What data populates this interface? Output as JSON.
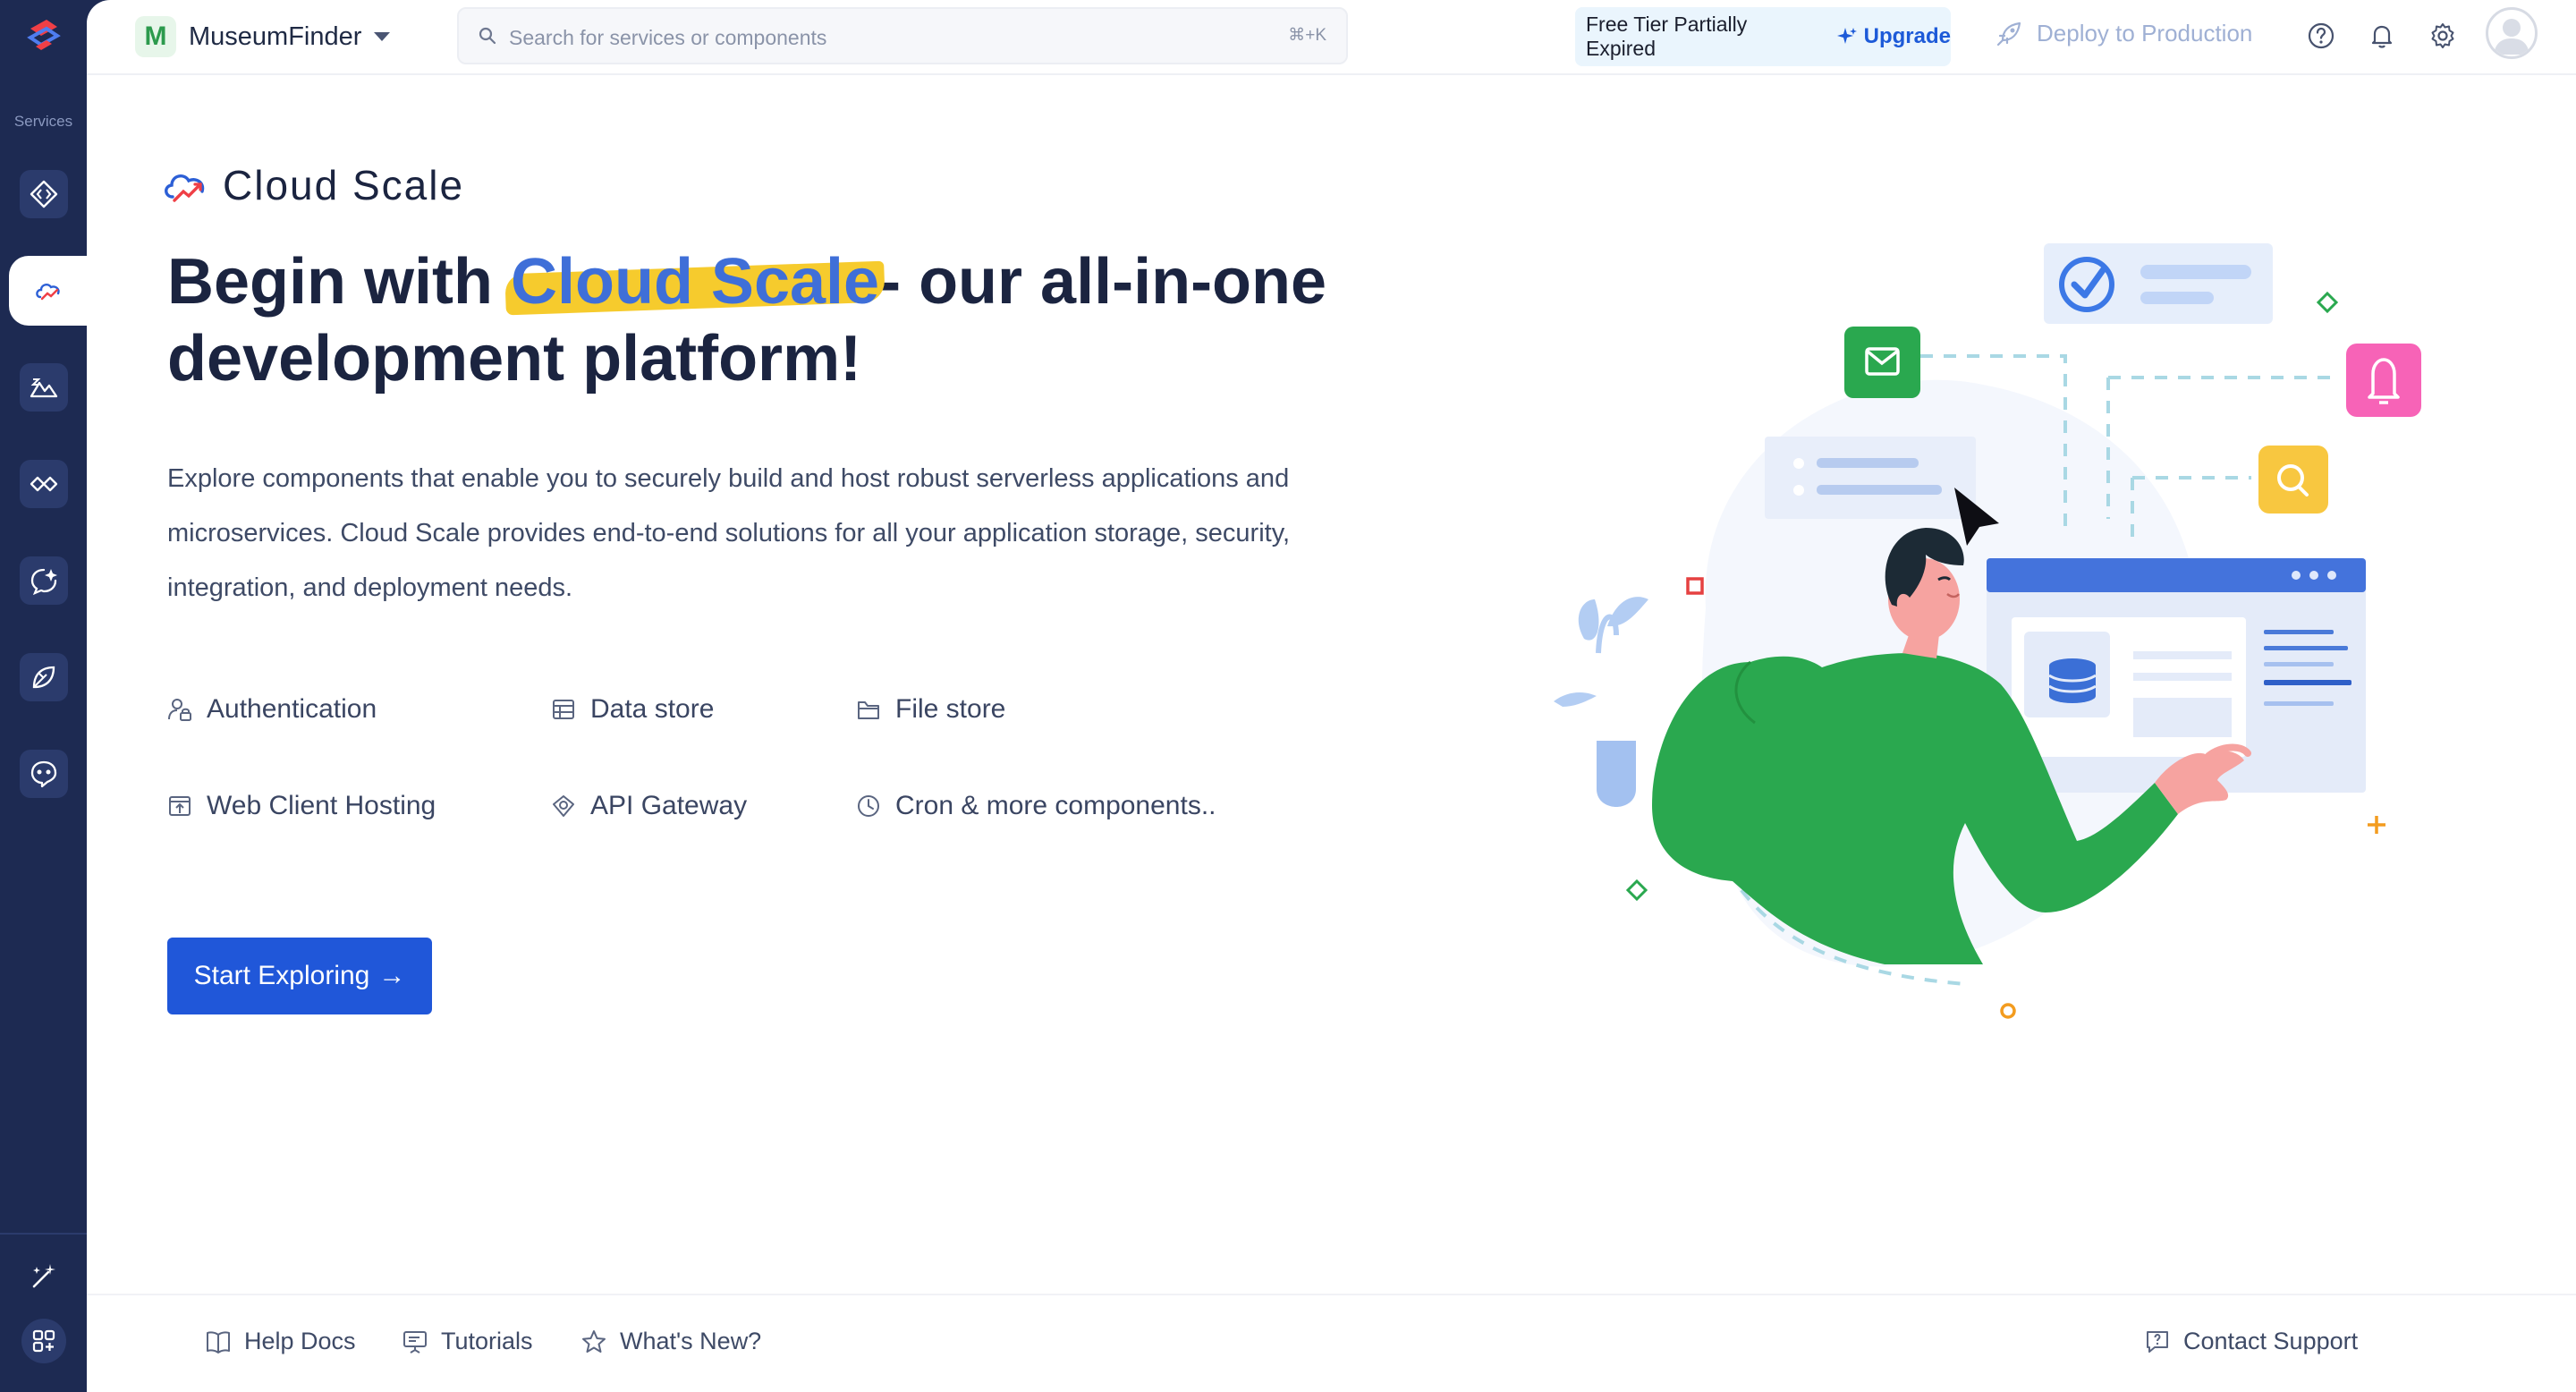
{
  "app": {
    "sidebar": {
      "section_label": "Services",
      "items": [
        {
          "name": "embedded-services",
          "icon": "code-diamond-icon",
          "active": false
        },
        {
          "name": "cloud-scale",
          "icon": "cloud-scale-icon",
          "active": true
        },
        {
          "name": "serverless",
          "icon": "mountain-icon",
          "active": false
        },
        {
          "name": "integration",
          "icon": "link-diamond-icon",
          "active": false
        },
        {
          "name": "ai-ml",
          "icon": "sparkle-bubble-icon",
          "active": false
        },
        {
          "name": "devops",
          "icon": "rocket-leaf-icon",
          "active": false
        },
        {
          "name": "analytics",
          "icon": "chat-face-icon",
          "active": false
        }
      ],
      "bottom": [
        {
          "name": "magic-tools",
          "icon": "magic-wand-icon"
        },
        {
          "name": "apps-menu",
          "icon": "grid-plus-icon"
        }
      ]
    },
    "header": {
      "project_initial": "M",
      "project_name": "MuseumFinder",
      "search_placeholder": "Search for services or components",
      "search_shortcut": "⌘+K",
      "tier_text": "Free Tier Partially Expired",
      "upgrade_label": "Upgrade",
      "deploy_label": "Deploy to Production"
    }
  },
  "hero": {
    "brand": "Cloud Scale",
    "headline_before": "Begin with ",
    "headline_highlight": "Cloud Scale",
    "headline_after": "- our all-in-one development platform!",
    "description": "Explore components that enable you to securely build and host robust serverless applications and microservices. Cloud Scale provides end-to-end solutions for all your application storage, security, integration, and deployment needs.",
    "features": [
      {
        "label": "Authentication",
        "icon": "user-lock-icon"
      },
      {
        "label": "Data store",
        "icon": "table-icon"
      },
      {
        "label": "File store",
        "icon": "folder-icon"
      },
      {
        "label": "Web Client Hosting",
        "icon": "web-upload-icon"
      },
      {
        "label": "API Gateway",
        "icon": "gateway-icon"
      },
      {
        "label": "Cron & more components..",
        "icon": "clock-icon"
      }
    ],
    "cta_label": "Start Exploring",
    "cta_arrow": "→"
  },
  "footer": {
    "help_docs": "Help Docs",
    "tutorials": "Tutorials",
    "whats_new": "What's New?",
    "contact_support": "Contact Support"
  },
  "colors": {
    "sidebar_bg": "#1d2a52",
    "primary": "#2057d9",
    "highlight": "#f6cb2d",
    "illustration_green": "#2aa84f"
  }
}
